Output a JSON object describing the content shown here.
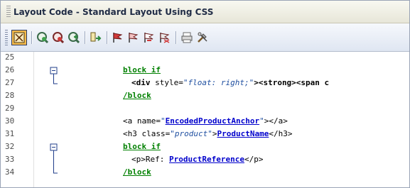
{
  "window": {
    "title": "Layout Code - Standard Layout Using CSS"
  },
  "toolbar": {
    "buttons": [
      "layout-view",
      "connect",
      "disconnect",
      "refresh",
      "insert-field",
      "flag-red",
      "flag-outline",
      "flag-next",
      "flag-clear",
      "print",
      "tools"
    ]
  },
  "code": {
    "lines": [
      {
        "n": "25",
        "parts": []
      },
      {
        "n": "26",
        "parts": [
          {
            "t": "block if",
            "c": "kw"
          }
        ]
      },
      {
        "n": "27",
        "indent": true,
        "parts": [
          {
            "t": "<div",
            "c": "tag"
          },
          {
            "t": " style=",
            "c": ""
          },
          {
            "t": "\"float: right;\"",
            "c": "str"
          },
          {
            "t": "><strong><span c",
            "c": "tag"
          }
        ]
      },
      {
        "n": "28",
        "parts": [
          {
            "t": "/block",
            "c": "kw2"
          }
        ]
      },
      {
        "n": "29",
        "parts": []
      },
      {
        "n": "30",
        "parts": [
          {
            "t": "<a",
            "c": ""
          },
          {
            "t": " name=",
            "c": ""
          },
          {
            "t": "\"",
            "c": "str"
          },
          {
            "t": "EncodedProductAnchor",
            "c": "lnk"
          },
          {
            "t": "\"",
            "c": "str"
          },
          {
            "t": "></a>",
            "c": ""
          }
        ]
      },
      {
        "n": "31",
        "parts": [
          {
            "t": "<h3",
            "c": ""
          },
          {
            "t": " class=",
            "c": ""
          },
          {
            "t": "\"product\"",
            "c": "str"
          },
          {
            "t": ">",
            "c": ""
          },
          {
            "t": "ProductName",
            "c": "lnk"
          },
          {
            "t": "</h3>",
            "c": ""
          }
        ]
      },
      {
        "n": "32",
        "parts": [
          {
            "t": "block if",
            "c": "kw"
          }
        ]
      },
      {
        "n": "33",
        "indent": true,
        "parts": [
          {
            "t": "<p>",
            "c": ""
          },
          {
            "t": "Ref: ",
            "c": ""
          },
          {
            "t": "ProductReference",
            "c": "lnk"
          },
          {
            "t": "</p>",
            "c": ""
          }
        ]
      },
      {
        "n": "34",
        "parts": [
          {
            "t": "/block",
            "c": "kw2"
          }
        ]
      }
    ]
  }
}
